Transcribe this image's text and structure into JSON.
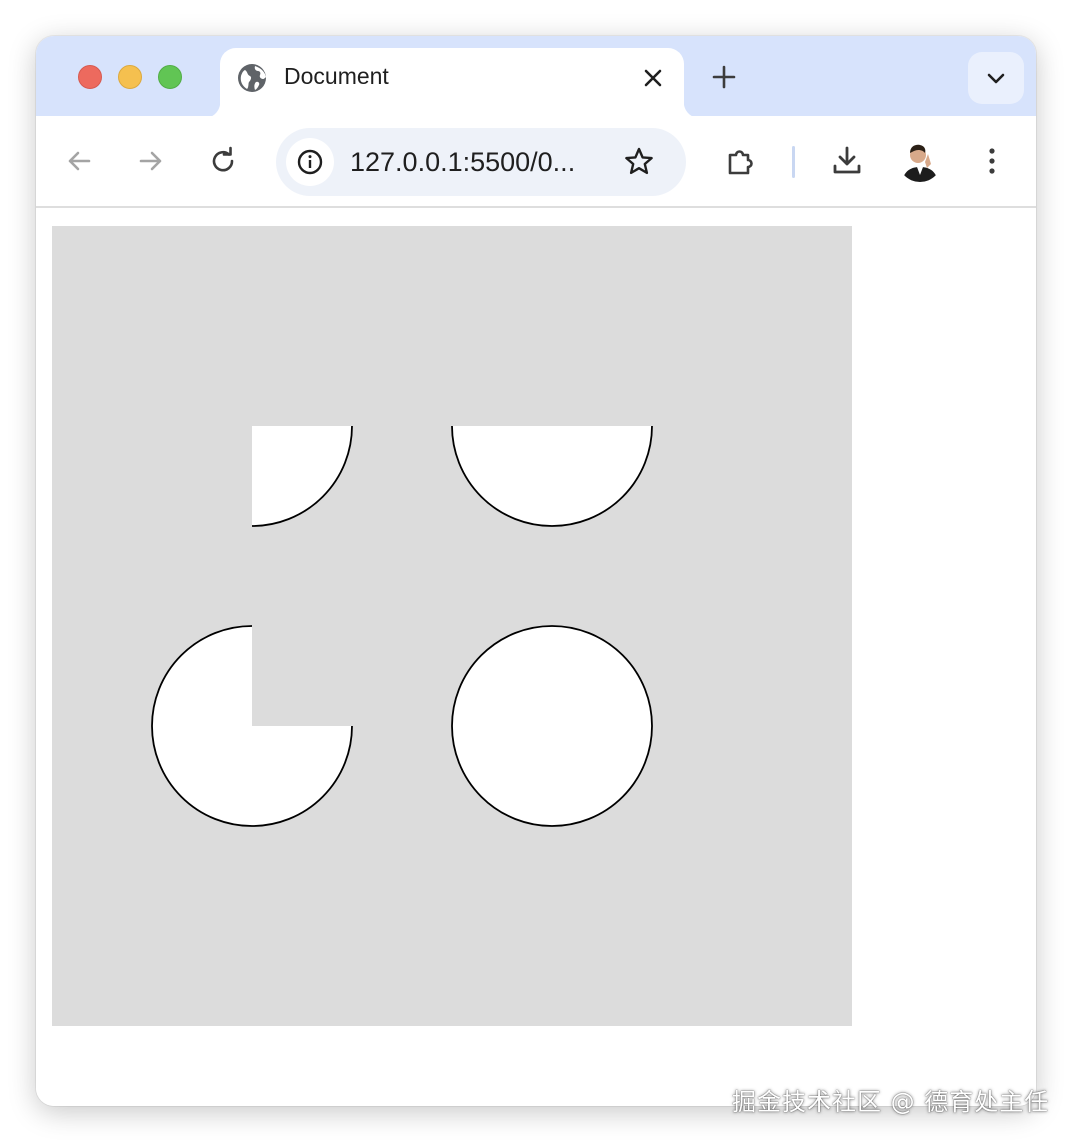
{
  "tab": {
    "title": "Document",
    "icon": "globe-icon"
  },
  "toolbar": {
    "url": "127.0.0.1:5500/0...",
    "back_icon": "arrow-left-icon",
    "forward_icon": "arrow-right-icon",
    "reload_icon": "reload-icon",
    "site_info_icon": "info-icon",
    "bookmark_icon": "star-icon",
    "extensions_icon": "puzzle-icon",
    "download_icon": "download-icon",
    "profile_icon": "avatar",
    "menu_icon": "kebab-menu-icon"
  },
  "page": {
    "canvas_color": "#dcdcdc",
    "shapes": [
      {
        "kind": "quarter-circle",
        "fill": "#ffffff",
        "stroke": "#000000"
      },
      {
        "kind": "half-circle",
        "fill": "#ffffff",
        "stroke": "#000000"
      },
      {
        "kind": "three-quarter-circle",
        "fill": "#ffffff",
        "stroke": "#000000"
      },
      {
        "kind": "full-circle",
        "fill": "#ffffff",
        "stroke": "#000000"
      }
    ]
  },
  "watermark": "掘金技术社区 @ 德育处主任",
  "colors": {
    "tabstrip": "#d7e3fc",
    "omnibox": "#eef2f9",
    "traffic_red": "#ed6a5e",
    "traffic_yellow": "#f5c04f",
    "traffic_green": "#61c554"
  }
}
